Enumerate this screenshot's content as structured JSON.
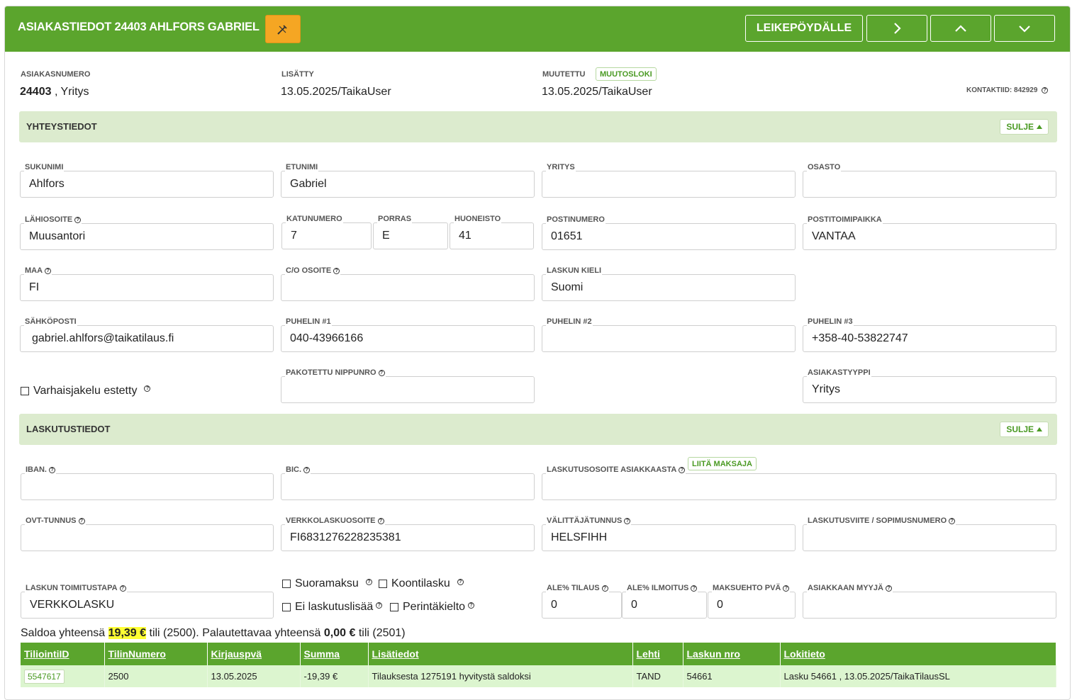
{
  "header": {
    "title": "ASIAKASTIEDOT 24403 AHLFORS GABRIEL",
    "clipboard_label": "LEIKEPÖYDÄLLE",
    "edit_icon": "pencil-cross-icon",
    "next_icon": "chevron-right-icon",
    "up_icon": "chevron-up-icon",
    "down_icon": "chevron-down-icon"
  },
  "meta": {
    "asiakasnumero_label": "ASIAKASNUMERO",
    "asiakasnumero_value": "24403",
    "asiakas_type": ", Yritys",
    "lisatty_label": "LISÄTTY",
    "lisatty_value": "13.05.2025/TaikaUser",
    "muutettu_label": "MUUTETTU",
    "muutosloki_label": "MUUTOSLOKI",
    "muutettu_value": "13.05.2025/TaikaUser",
    "kontaktiid_label": "KONTAKTIID:",
    "kontaktiid_value": "842929"
  },
  "yhteystiedot": {
    "title": "YHTEYSTIEDOT",
    "close_label": "SULJE",
    "sukunimi_label": "SUKUNIMI",
    "sukunimi": "Ahlfors",
    "etunimi_label": "ETUNIMI",
    "etunimi": "Gabriel",
    "yritys_label": "YRITYS",
    "yritys": "",
    "osasto_label": "OSASTO",
    "osasto": "",
    "lahiosoite_label": "LÄHIOSOITE",
    "lahiosoite": "Muusantori",
    "katunumero_label": "KATUNUMERO",
    "katunumero": "7",
    "porras_label": "PORRAS",
    "porras": "E",
    "huoneisto_label": "HUONEISTO",
    "huoneisto": "41",
    "postinumero_label": "POSTINUMERO",
    "postinumero": "01651",
    "postitoimipaikka_label": "POSTITOIMIPAIKKA",
    "postitoimipaikka": "VANTAA",
    "maa_label": "MAA",
    "maa": "FI",
    "co_label": "C/O OSOITE",
    "co": "",
    "laskun_kieli_label": "LASKUN KIELI",
    "laskun_kieli": "Suomi",
    "sahkoposti_label": "SÄHKÖPOSTI",
    "sahkoposti": "gabriel.ahlfors@taikatilaus.fi",
    "puhelin1_label": "PUHELIN #1",
    "puhelin1": "040-43966166",
    "puhelin2_label": "PUHELIN #2",
    "puhelin2": "",
    "puhelin3_label": "PUHELIN #3",
    "puhelin3": "+358-40-53822747",
    "varhaisjakelu_label": "Varhaisjakelu estetty",
    "nippunro_label": "PAKOTETTU NIPPUNRO",
    "nippunro": "",
    "asiakastyyppi_label": "ASIAKASTYYPPI",
    "asiakastyyppi": "Yritys"
  },
  "laskutustiedot": {
    "title": "LASKUTUSTIEDOT",
    "close_label": "SULJE",
    "iban_label": "IBAN.",
    "iban": "",
    "bic_label": "BIC.",
    "bic": "",
    "laskutusosoite_label": "LASKUTUSOSOITE ASIAKKAASTA",
    "liita_maksaja_label": "LIITÄ MAKSAJA",
    "laskutusosoite": "",
    "ovt_label": "OVT-TUNNUS",
    "ovt": "",
    "verkkolaskuosoite_label": "VERKKOLASKUOSOITE",
    "verkkolaskuosoite": "FI6831276228235381",
    "valittajatunnus_label": "VÄLITTÄJÄTUNNUS",
    "valittajatunnus": "HELSFIHH",
    "laskutusviite_label": "LASKUTUSVIITE / SOPIMUSNUMERO",
    "laskutusviite": "",
    "toimitustapa_label": "LASKUN TOIMITUSTAPA",
    "toimitustapa": "VERKKOLASKU",
    "suoramaksu_label": "Suoramaksu",
    "koontilasku_label": "Koontilasku",
    "ei_laskutuslisaa_label": "Ei laskutuslisää",
    "perintakielto_label": "Perintäkielto",
    "ale_tilaus_label": "ALE% TILAUS",
    "ale_tilaus": "0",
    "ale_ilmoitus_label": "ALE% ILMOITUS",
    "ale_ilmoitus": "0",
    "maksuehto_label": "MAKSUEHTO PVÄ",
    "maksuehto": "0",
    "myyja_label": "ASIAKKAAN MYYJÄ",
    "myyja": ""
  },
  "saldo": {
    "prefix": "Saldoa yhteensä",
    "amount": "19,39 €",
    "middle": "tili (2500). Palautettavaa yhteensä",
    "return_amount": "0,00 €",
    "suffix": "tili (2501)"
  },
  "table": {
    "columns": [
      "TiliointiID",
      "TilinNumero",
      "Kirjauspvä",
      "Summa",
      "Lisätiedot",
      "Lehti",
      "Laskun nro",
      "Lokitieto"
    ],
    "rows": [
      [
        "5547617",
        "2500",
        "13.05.2025",
        "-19,39 €",
        "Tilauksesta 1275191 hyvitystä saldoksi",
        "TAND",
        "54661",
        "Lasku 54661 , 13.05.2025/TaikaTilausSL"
      ]
    ]
  },
  "colors": {
    "accent": "#5ba52d",
    "section_bg": "#dcebce",
    "edit_button": "#f5a623",
    "highlight": "#ffff33"
  }
}
